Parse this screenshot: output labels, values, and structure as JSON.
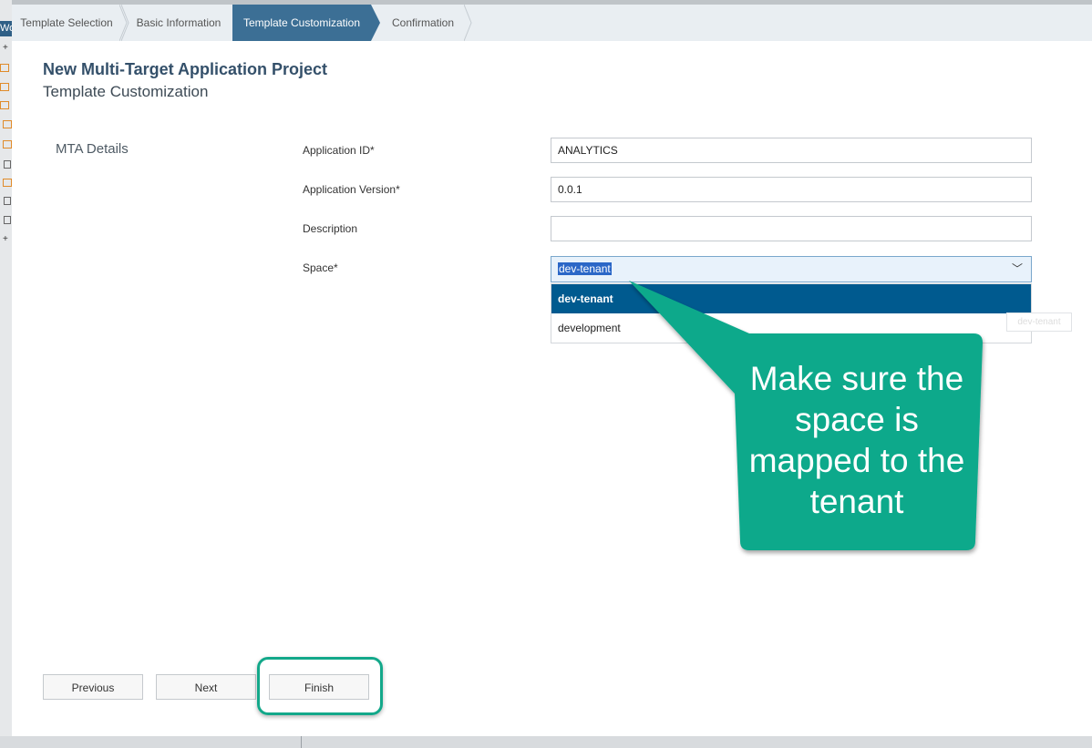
{
  "wizard": {
    "steps": [
      {
        "label": "Template Selection",
        "active": false
      },
      {
        "label": "Basic Information",
        "active": false
      },
      {
        "label": "Template Customization",
        "active": true
      },
      {
        "label": "Confirmation",
        "active": false
      }
    ]
  },
  "header": {
    "title": "New Multi-Target Application Project",
    "subtitle": "Template Customization"
  },
  "form": {
    "section_label": "MTA Details",
    "application_id": {
      "label": "Application ID*",
      "value": "ANALYTICS"
    },
    "application_version": {
      "label": "Application Version*",
      "value": "0.0.1"
    },
    "description": {
      "label": "Description",
      "value": ""
    },
    "space": {
      "label": "Space*",
      "value": "dev-tenant",
      "options": [
        "dev-tenant",
        "development"
      ],
      "highlighted_option": "dev-tenant"
    },
    "ghost_tooltip": "dev-tenant"
  },
  "footer": {
    "previous_label": "Previous",
    "next_label": "Next",
    "finish_label": "Finish"
  },
  "annotation": {
    "callout_text": "Make sure the space is mapped to the tenant",
    "color": "#0aa98b"
  },
  "background": {
    "left_strip_text": "Wor"
  },
  "colors": {
    "active_step": "#3c6f95",
    "selected_option": "#005a8f",
    "title": "#34506a"
  }
}
